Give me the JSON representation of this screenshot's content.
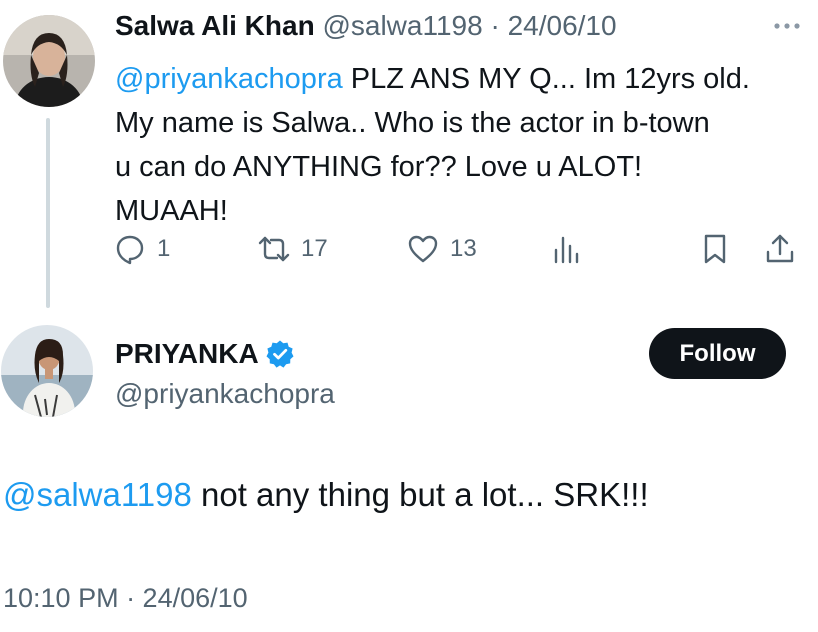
{
  "reply_to": {
    "display_name": "Salwa Ali Khan",
    "handle": "@salwa1198",
    "date": "· 24/06/10",
    "mention": "@priyankachopra",
    "text_lines": [
      " PLZ ANS MY Q... Im 12yrs old.",
      "My name is Salwa.. Who is the actor in b-town",
      "u can do ANYTHING for?? Love u ALOT!",
      "MUAAH!"
    ],
    "counts": {
      "replies": "1",
      "reposts": "17",
      "likes": "13"
    },
    "icons": [
      "more-icon",
      "reply-icon",
      "repost-icon",
      "like-icon",
      "views-icon",
      "bookmark-icon",
      "share-icon"
    ]
  },
  "tweet": {
    "display_name": "PRIYANKA",
    "handle": "@priyankachopra",
    "follow_label": "Follow",
    "mention": "@salwa1198",
    "text": " not any thing but a lot... SRK!!!",
    "timestamp": "10:10 PM · 24/06/10"
  },
  "colors": {
    "link": "#1d9bf0",
    "muted": "#536471",
    "text": "#0f1419",
    "verified": "#1d9bf0",
    "follow_bg": "#0f1419"
  }
}
